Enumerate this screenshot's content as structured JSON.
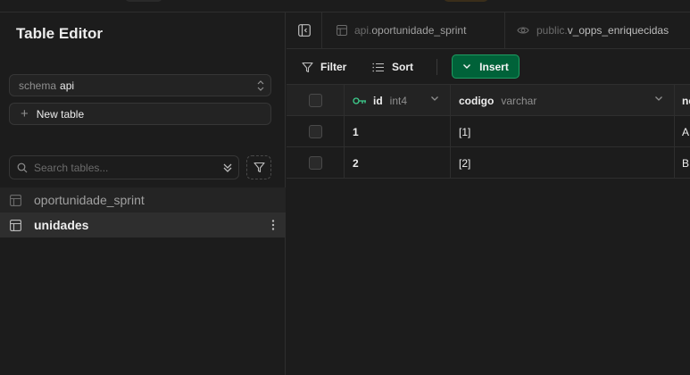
{
  "sidebar": {
    "title": "Table Editor",
    "schema_label": "schema",
    "schema_value": "api",
    "new_table_label": "New table",
    "search_placeholder": "Search tables...",
    "tables": [
      {
        "name": "oportunidade_sprint"
      },
      {
        "name": "unidades"
      }
    ]
  },
  "tabs": [
    {
      "schema": "api.",
      "name": "oportunidade_sprint",
      "icon": "table-icon"
    },
    {
      "schema": "public.",
      "name": "v_opps_enriquecidas",
      "icon": "eye-icon"
    }
  ],
  "toolbar": {
    "filter_label": "Filter",
    "sort_label": "Sort",
    "insert_label": "Insert"
  },
  "grid": {
    "columns": [
      {
        "name": "id",
        "type": "int4",
        "is_primary_key": true
      },
      {
        "name": "codigo",
        "type": "varchar"
      },
      {
        "name": "ne",
        "type": ""
      }
    ],
    "rows": [
      {
        "id": "1",
        "codigo": "[1]",
        "ne": "A"
      },
      {
        "id": "2",
        "codigo": "[2]",
        "ne": "B"
      }
    ]
  },
  "colors": {
    "background": "#1c1c1c",
    "accent_green": "#006239",
    "accent_green_border": "#1f9d62",
    "key_icon": "#3ecf8e"
  }
}
